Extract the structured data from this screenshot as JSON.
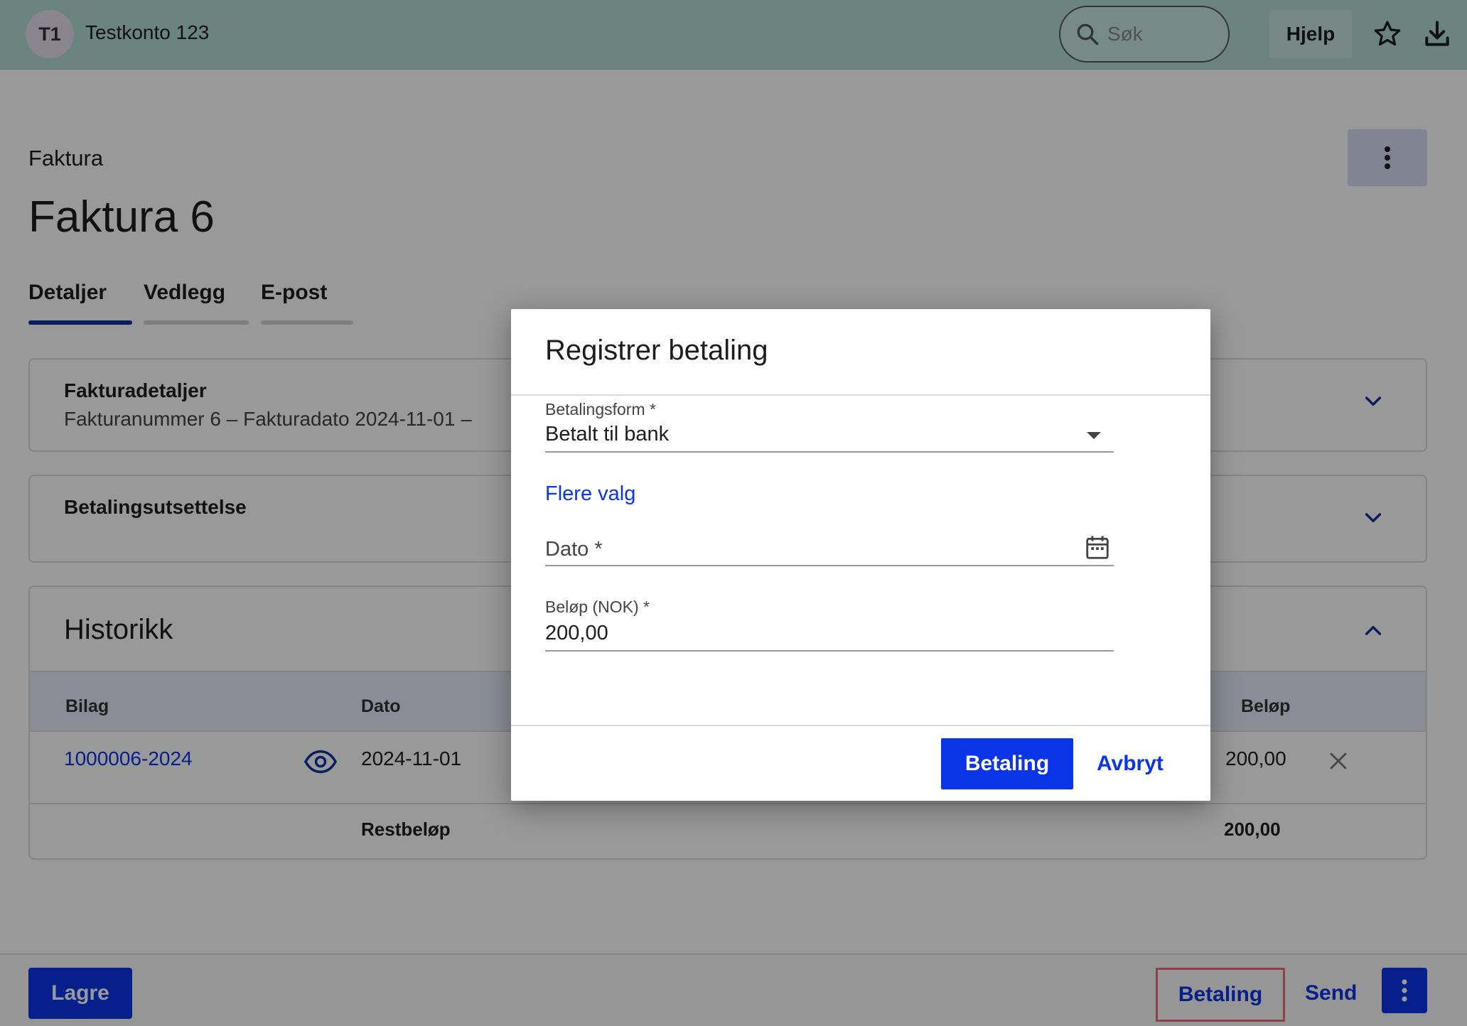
{
  "header": {
    "avatar_initials": "T1",
    "account_name": "Testkonto 123",
    "search_placeholder": "Søk",
    "help_label": "Hjelp",
    "icons": [
      "search-icon",
      "star-icon",
      "download-icon"
    ]
  },
  "page": {
    "breadcrumb": "Faktura",
    "title": "Faktura 6",
    "tabs": [
      {
        "label": "Detaljer",
        "active": true
      },
      {
        "label": "Vedlegg",
        "active": false
      },
      {
        "label": "E-post",
        "active": false
      }
    ]
  },
  "sections": {
    "details": {
      "title": "Fakturadetaljer",
      "subtitle": "Fakturanummer 6  –  Fakturadato 2024-11-01  –"
    },
    "payment_deferral": {
      "title": "Betalingsutsettelse"
    },
    "history": {
      "title": "Historikk",
      "columns": {
        "voucher": "Bilag",
        "date": "Dato",
        "amount": "Beløp"
      },
      "rows": [
        {
          "voucher": "1000006-2024",
          "date": "2024-11-01",
          "amount": "200,00"
        }
      ],
      "remaining_label": "Restbeløp",
      "remaining_amount": "200,00"
    }
  },
  "bottom_bar": {
    "save_label": "Lagre",
    "payment_label": "Betaling",
    "send_label": "Send"
  },
  "modal": {
    "title": "Registrer betaling",
    "payment_method_label": "Betalingsform *",
    "payment_method_value": "Betalt til bank",
    "more_options": "Flere valg",
    "date_label": "Dato *",
    "amount_label": "Beløp (NOK) *",
    "amount_value": "200,00",
    "submit_label": "Betaling",
    "cancel_label": "Avbryt"
  },
  "colors": {
    "primary": "#0a35e6",
    "topbar": "#b3dcd6",
    "tab_active": "#0f2f9f",
    "highlight_border": "#e8707e"
  }
}
